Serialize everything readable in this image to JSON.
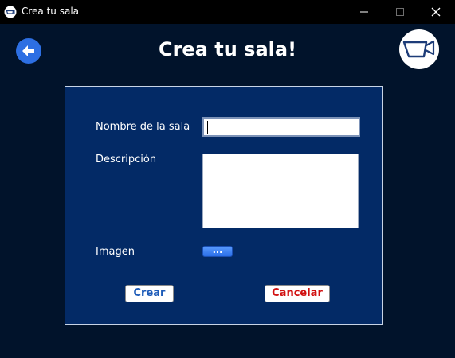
{
  "window": {
    "title": "Crea tu sala",
    "controls": {
      "minimize": "minimize-icon",
      "maximize": "maximize-icon",
      "close": "close-icon"
    }
  },
  "header": {
    "title": "Crea tu sala!",
    "back_icon": "arrow-left-icon",
    "logo_icon": "video-camera-icon"
  },
  "form": {
    "name_label": "Nombre de la sala",
    "name_value": "",
    "description_label": "Descripción",
    "description_value": "",
    "image_label": "Imagen",
    "browse_label": "...",
    "create_label": "Crear",
    "cancel_label": "Cancelar"
  },
  "colors": {
    "background": "#01132b",
    "panel": "#032a66",
    "accent": "#2d6fe3",
    "create_text": "#1d5bb8",
    "cancel_text": "#d11010"
  }
}
